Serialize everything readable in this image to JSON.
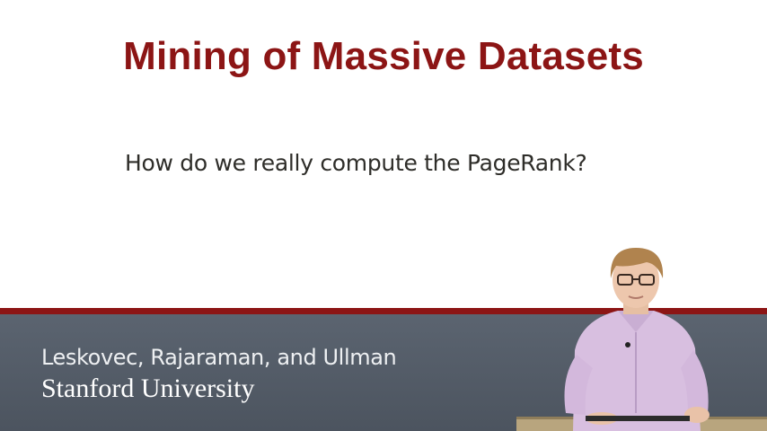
{
  "slide": {
    "title": "Mining of Massive Datasets",
    "subtitle": "How do we really compute the PageRank?"
  },
  "footer": {
    "authors": "Leskovec, Rajaraman, and Ullman",
    "institution": "Stanford University"
  },
  "colors": {
    "brand_red": "#8c1515",
    "footer_gray": "#535b66",
    "title_text": "#8c1515",
    "body_text": "#2e2d29"
  },
  "presenter": {
    "icon": "presenter-video-figure"
  }
}
